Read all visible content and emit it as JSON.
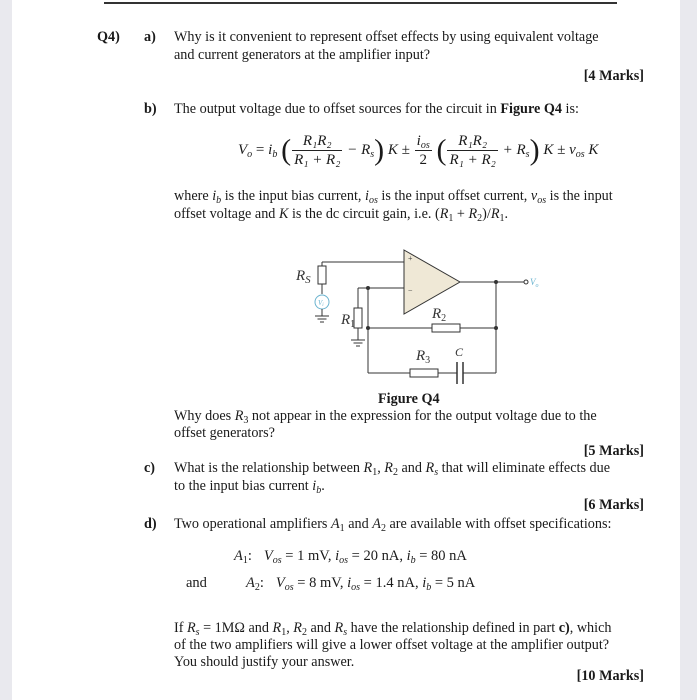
{
  "question": {
    "number": "Q4)",
    "parts": {
      "a": {
        "label": "a)",
        "line1": "Why is it convenient to represent offset effects by using equivalent voltage",
        "line2": "and current generators at the amplifier input?",
        "marks": "[4 Marks]"
      },
      "b": {
        "label": "b)",
        "intro_prefix": "The output voltage due to offset sources for the circuit in ",
        "intro_bold": "Figure Q4",
        "intro_suffix": " is:",
        "formula": {
          "lhs": "V",
          "lhs_sub": "o",
          "eq": " = ",
          "ib": "i",
          "ib_sub": "b",
          "frac_num": "R₁R₂",
          "frac_den": "R₁ + R₂",
          "minus_rs": " − R",
          "rs_sub": "s",
          "k1": " K ± ",
          "ios_num": "i",
          "ios_sub": "os",
          "ios_den": "2",
          "plus_rs": " + R",
          "k2": " K ± ",
          "vos": "v",
          "vos_sub": "os",
          "k3": " K"
        },
        "where_line1": {
          "t1": "where ",
          "ib": "i",
          "ib_sub": "b",
          "t2": " is the input bias current, ",
          "ios": "i",
          "ios_sub": "os",
          "t3": " is the input offset current, ",
          "vos": "v",
          "vos_sub": "os",
          "t4": " is the input"
        },
        "where_line2": {
          "t1": "offset voltage and ",
          "k": "K",
          "t2": " is the dc circuit gain, i.e. (",
          "r1": "R",
          "s1": "1",
          "plus": " + ",
          "r2": "R",
          "s2": "2",
          "t3": ")/",
          "r3": "R",
          "s3": "1",
          "t4": "."
        },
        "figure": {
          "caption": "Figure Q4",
          "labels": {
            "rs": "R",
            "rs_sub": "S",
            "r1": "R",
            "r1_sub": "1",
            "r2": "R",
            "r2_sub": "2",
            "r3": "R",
            "r3_sub": "3",
            "c": "C",
            "vo": "V",
            "vo_sub": "o",
            "vi": "V",
            "vi_sub": "i",
            "plus": "+",
            "minus": "−"
          },
          "colors": {
            "opamp_fill": "#efe8d6",
            "wire": "#333333",
            "source_accent": "#6ab3cf"
          }
        },
        "question_line1_prefix": "Why does ",
        "question_r": "R",
        "question_r_sub": "3",
        "question_line1_suffix": " not appear in the expression for the output voltage due to the",
        "question_line2": "offset generators?",
        "marks": "[5 Marks]"
      },
      "c": {
        "label": "c)",
        "line1_prefix": "What is the relationship between ",
        "r1": "R",
        "r1_sub": "1",
        "comma": ", ",
        "r2": "R",
        "r2_sub": "2",
        "and": " and ",
        "rs": "R",
        "rs_sub": "s",
        "line1_suffix": " that will eliminate effects due",
        "line2_prefix": "to the input bias current ",
        "ib": "i",
        "ib_sub": "b",
        "line2_suffix": ".",
        "marks": "[6 Marks]"
      },
      "d": {
        "label": "d)",
        "intro_prefix": "Two operational amplifiers ",
        "a1": "A",
        "a1_sub": "1",
        "and": " and ",
        "a2": "A",
        "a2_sub": "2",
        "intro_suffix": " are available with offset specifications:",
        "amplifiers": [
          {
            "prefix": "",
            "name": "A",
            "sub": "1",
            "vos": "1 mV",
            "ios": "20 nA",
            "ib": "80 nA"
          },
          {
            "prefix": "and",
            "name": "A",
            "sub": "2",
            "vos": "8 mV",
            "ios": "1.4 nA",
            "ib": "5 nA"
          }
        ],
        "spec_labels": {
          "v": "V",
          "os": "os",
          "i": "i",
          "b": "b",
          "eq": " = ",
          "sep": ", "
        },
        "follow_line1": {
          "t1": "If ",
          "rs": "R",
          "rs_sub": "s",
          "t2": " = 1MΩ and ",
          "r1": "R",
          "r1_sub": "1",
          "comma": ", ",
          "r2": "R",
          "r2_sub": "2",
          "t3": " and ",
          "rs2": "R",
          "rs2_sub": "s",
          "t4": " have the relationship defined in part ",
          "bold": "c)",
          "t5": ", which"
        },
        "follow_line2": "of the two amplifiers will give a lower offset voltage at the amplifier output?",
        "follow_line3": "You should justify your answer.",
        "marks": "[10 Marks]"
      }
    }
  }
}
